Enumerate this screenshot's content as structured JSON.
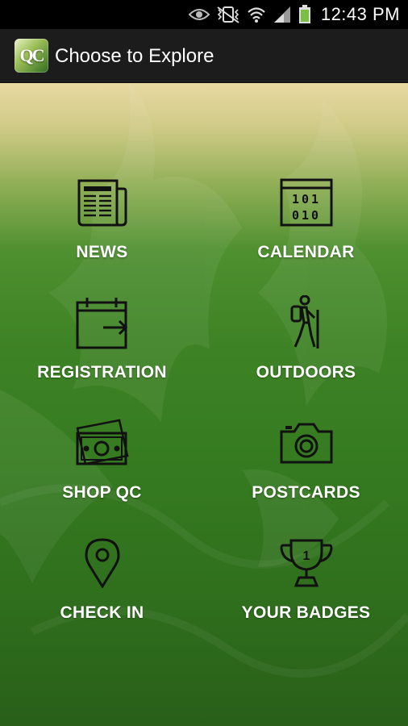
{
  "status_bar": {
    "time": "12:43 PM",
    "icons": [
      "eye-icon",
      "vibrate-mute-icon",
      "wifi-icon",
      "signal-icon",
      "battery-icon"
    ]
  },
  "action_bar": {
    "logo_text": "QC",
    "title": "Choose to Explore"
  },
  "menu": {
    "items": [
      {
        "label": "NEWS",
        "icon": "newspaper-icon"
      },
      {
        "label": "CALENDAR",
        "icon": "binary-calendar-icon"
      },
      {
        "label": "REGISTRATION",
        "icon": "calendar-arrow-icon"
      },
      {
        "label": "OUTDOORS",
        "icon": "hiker-icon"
      },
      {
        "label": "SHOP QC",
        "icon": "money-icon"
      },
      {
        "label": "POSTCARDS",
        "icon": "camera-icon"
      },
      {
        "label": "CHECK IN",
        "icon": "map-pin-icon"
      },
      {
        "label": "YOUR BADGES",
        "icon": "trophy-icon"
      }
    ]
  },
  "colors": {
    "accent_green": "#3e8325",
    "top_tan": "#e8d9a2",
    "icon_stroke": "#111111",
    "label": "#ffffff"
  }
}
